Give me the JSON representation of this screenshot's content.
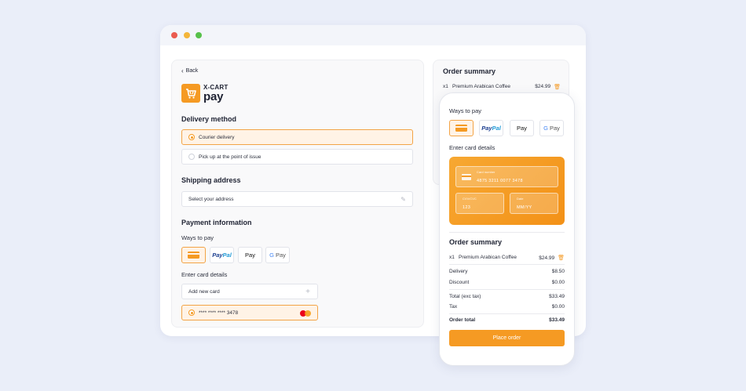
{
  "checkout": {
    "back_label": "Back",
    "brand": {
      "line1": "X-CART",
      "line2": "pay"
    },
    "delivery": {
      "heading": "Delivery method",
      "options": [
        {
          "label": "Courier delivery",
          "selected": true
        },
        {
          "label": "Pick up at the point of issue",
          "selected": false
        }
      ]
    },
    "shipping": {
      "heading": "Shipping address",
      "placeholder": "Select your address"
    },
    "payment": {
      "heading": "Payment information",
      "ways_label": "Ways to pay",
      "methods": [
        {
          "icon": "card-icon"
        },
        {
          "label_a": "Pay",
          "label_b": "Pal"
        },
        {
          "label": "Pay",
          "icon": "apple-icon"
        },
        {
          "label": "Pay",
          "icon": "google-g-icon"
        }
      ],
      "card_details_label": "Enter card details",
      "add_card_label": "Add new card",
      "saved_card": "**** **** **** 3478"
    }
  },
  "summary_desktop": {
    "title": "Order summary",
    "item": {
      "qty": "x1",
      "name": "Premium Arabican Coffee",
      "price": "$24.99"
    }
  },
  "mobile": {
    "ways_label": "Ways to pay",
    "card_details_label": "Enter card details",
    "card": {
      "number_label": "Card number",
      "number": "4875 3211 0077 3478",
      "cvv_label": "CVV/CVC",
      "cvv": "123",
      "expiry_label": "Date",
      "expiry": "MM/YY"
    },
    "summary": {
      "title": "Order summary",
      "item": {
        "qty": "x1",
        "name": "Premium Arabican Coffee",
        "price": "$24.99"
      },
      "delivery_label": "Delivery",
      "delivery": "$8.50",
      "discount_label": "Discount",
      "discount": "$0.00",
      "total_exc_label": "Total (exc tax)",
      "total_exc": "$33.49",
      "tax_label": "Tax",
      "tax": "$0.00",
      "order_total_label": "Order total",
      "order_total": "$33.49"
    },
    "place_order_label": "Place order"
  },
  "colors": {
    "accent": "#f59a23",
    "background": "#eaeef9",
    "selected_bg": "#fff3e6"
  }
}
